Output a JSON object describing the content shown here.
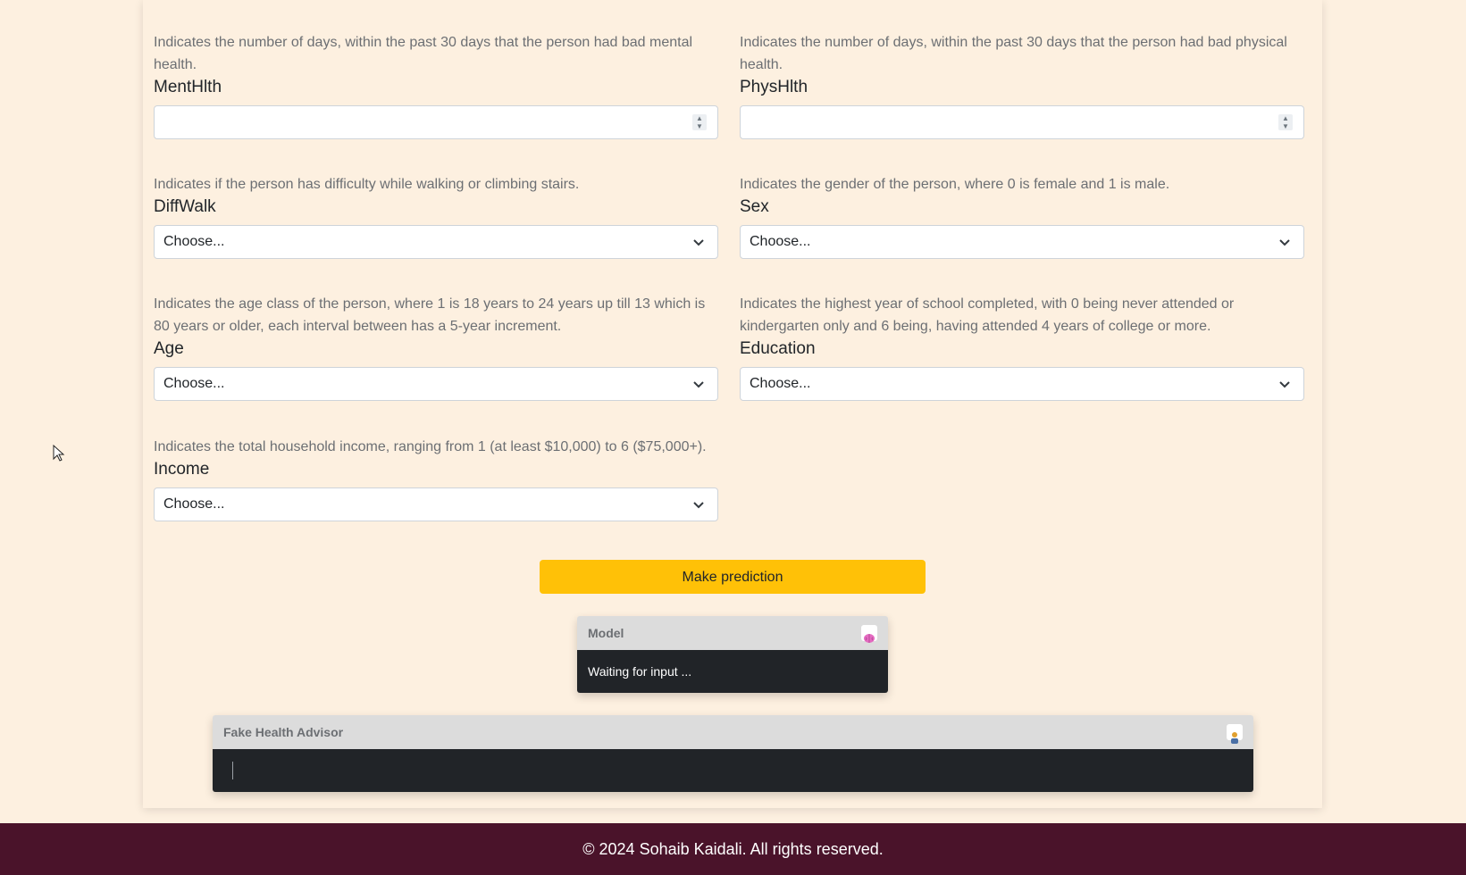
{
  "form": {
    "menthlth": {
      "hint": "Indicates the number of days, within the past 30 days that the person had bad mental health.",
      "label": "MentHlth",
      "value": ""
    },
    "physhlth": {
      "hint": "Indicates the number of days, within the past 30 days that the person had bad physical health.",
      "label": "PhysHlth",
      "value": ""
    },
    "diffwalk": {
      "hint": "Indicates if the person has difficulty while walking or climbing stairs.",
      "label": "DiffWalk",
      "selected": "Choose..."
    },
    "sex": {
      "hint": "Indicates the gender of the person, where 0 is female and 1 is male.",
      "label": "Sex",
      "selected": "Choose..."
    },
    "age": {
      "hint": "Indicates the age class of the person, where 1 is 18 years to 24 years up till 13 which is 80 years or older, each interval between has a 5-year increment.",
      "label": "Age",
      "selected": "Choose..."
    },
    "education": {
      "hint": "Indicates the highest year of school completed, with 0 being never attended or kindergarten only and 6 being, having attended 4 years of college or more.",
      "label": "Education",
      "selected": "Choose..."
    },
    "income": {
      "hint": "Indicates the total household income, ranging from 1 (at least $10,000) to 6 ($75,000+).",
      "label": "Income",
      "selected": "Choose..."
    }
  },
  "actions": {
    "predict_label": "Make prediction"
  },
  "model_panel": {
    "title": "Model",
    "icon": "brain-icon",
    "status": "Waiting for input ..."
  },
  "advisor_panel": {
    "title": "Fake Health Advisor",
    "icon": "person-icon",
    "output": ""
  },
  "footer": {
    "text": "© 2024 Sohaib Kaidali. All rights reserved."
  }
}
